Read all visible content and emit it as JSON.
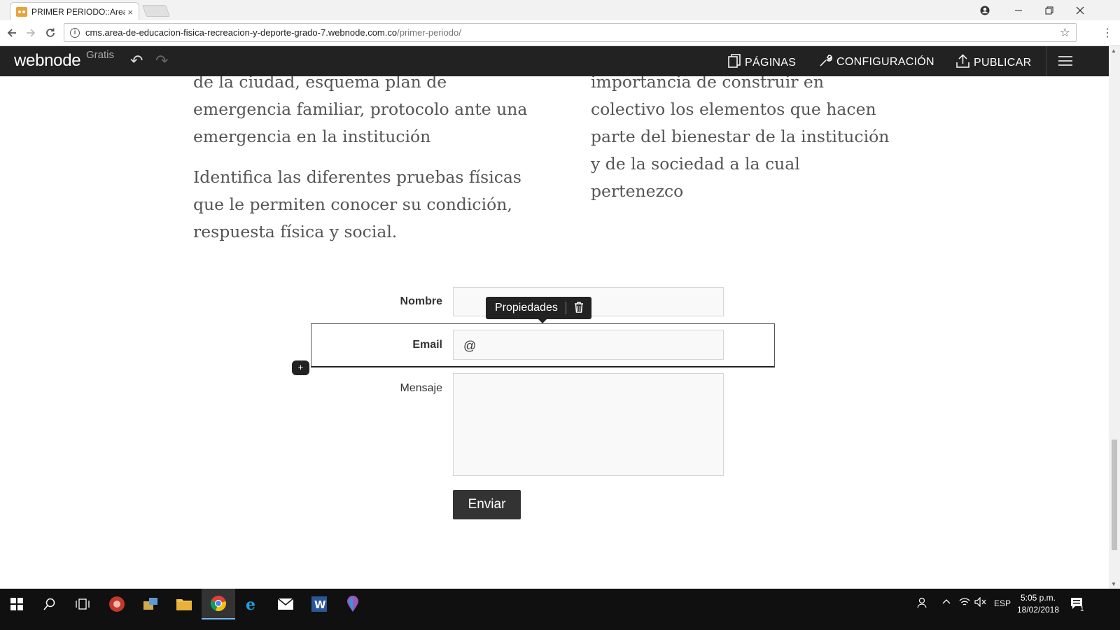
{
  "browser": {
    "tab_title": "PRIMER PERIODO::Area-d",
    "tab_close": "×",
    "url_host": "cms.area-de-educacion-fisica-recreacion-y-deporte-grado-7.webnode.com.co",
    "url_path": "/primer-periodo/"
  },
  "webnode_bar": {
    "logo": "webnode",
    "plan": "Gratis",
    "pages_label": "PÁGINAS",
    "config_label": "CONFIGURACIÓN",
    "publish_label": "PUBLICAR"
  },
  "content": {
    "left_col": [
      "de la ciudad, esquema plan de emergencia familiar, protocolo ante una emergencia en la institución",
      "Identifica las diferentes pruebas físicas que le permiten conocer su condición, respuesta física y social."
    ],
    "right_col": [
      "importancia de construir en colectivo los elementos que hacen parte del bienestar de la institución y de la sociedad a la cual pertenezco"
    ]
  },
  "form": {
    "name_label": "Nombre",
    "email_label": "Email",
    "email_value": "@",
    "message_label": "Mensaje",
    "submit_label": "Enviar",
    "toolbar_props": "Propiedades",
    "add_label": "+"
  },
  "taskbar": {
    "lang": "ESP",
    "time": "5:05 p.m.",
    "date": "18/02/2018",
    "notif_count": "1"
  }
}
